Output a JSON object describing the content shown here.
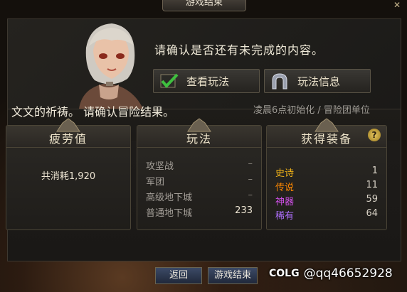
{
  "window": {
    "title": "游戏结束",
    "close_glyph": "✕"
  },
  "dialog": {
    "prompt": "请确认是否还有未完成的内容。",
    "buttons": {
      "view_gameplay": "查看玩法",
      "gameplay_info": "玩法信息"
    }
  },
  "summary": {
    "blessing": "文文的祈祷。 请确认冒险结果。",
    "reset_notice": "凌晨6点初始化 / 冒险团单位"
  },
  "fatigue": {
    "title": "疲劳值",
    "total_label": "共消耗",
    "total_value": "1,920"
  },
  "gameplay": {
    "title": "玩法",
    "rows": [
      {
        "name": "攻坚战",
        "value": "–"
      },
      {
        "name": "军团",
        "value": "–"
      },
      {
        "name": "高级地下城",
        "value": "–"
      },
      {
        "name": "普通地下城",
        "value": "233"
      }
    ]
  },
  "gear": {
    "title": "获得装备",
    "help_glyph": "?",
    "rows": [
      {
        "name": "史诗",
        "value": "1",
        "color": "#f2b418"
      },
      {
        "name": "传说",
        "value": "11",
        "color": "#ff8800"
      },
      {
        "name": "神器",
        "value": "59",
        "color": "#d050e8"
      },
      {
        "name": "稀有",
        "value": "64",
        "color": "#b070ff"
      }
    ]
  },
  "footer": {
    "back": "返回",
    "end_game": "游戏结束"
  },
  "watermark": {
    "logo": "COLG",
    "text": "@qq46652928"
  },
  "colors": {
    "accent_check": "#3fbf3f",
    "gold": "#e8c860"
  },
  "icons": {
    "view_gameplay": "checkmark-icon",
    "gameplay_info": "arch-icon",
    "panel_crest": "crest-icon"
  }
}
